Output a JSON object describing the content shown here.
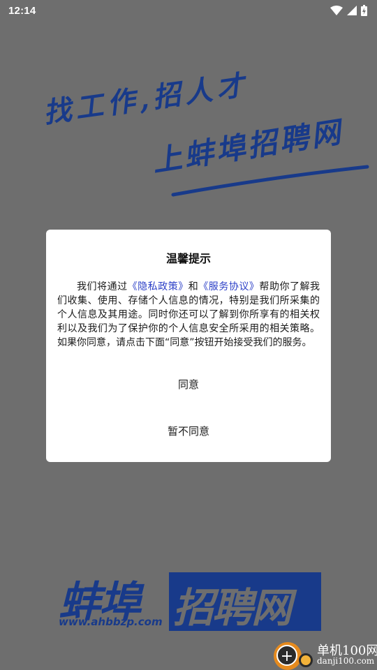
{
  "status_bar": {
    "time": "12:14",
    "icons": [
      "wifi-icon",
      "signal-icon",
      "battery-charging-icon"
    ]
  },
  "splash": {
    "slogan_line1": "找工作,招人才",
    "slogan_line2": "上蚌埠招聘网",
    "logo_part1": "蚌埠",
    "logo_part2": "招聘网",
    "logo_url": "www.ahbbzp.com"
  },
  "dialog": {
    "title": "温馨提示",
    "body_intro": "我们将通过",
    "privacy_link": "《隐私政策》",
    "body_and": "和",
    "service_link": "《服务协议》",
    "body_rest": "帮助你了解我们收集、使用、存储个人信息的情况，特别是我们所采集的个人信息及其用途。同时你还可以了解到你所享有的相关权利以及我们为了保护你的个人信息安全所采用的相关策略。如果你同意，请点击下面“同意”按钮开始接受我们的服务。",
    "agree_label": "同意",
    "disagree_label": "暂不同意"
  },
  "watermark": {
    "name": "单机100网",
    "url": "danji100.com"
  },
  "colors": {
    "overlay": "#6e6e6e",
    "brand_blue": "#183a8a",
    "link": "#2b3fc7",
    "dialog_bg": "#ffffff"
  }
}
